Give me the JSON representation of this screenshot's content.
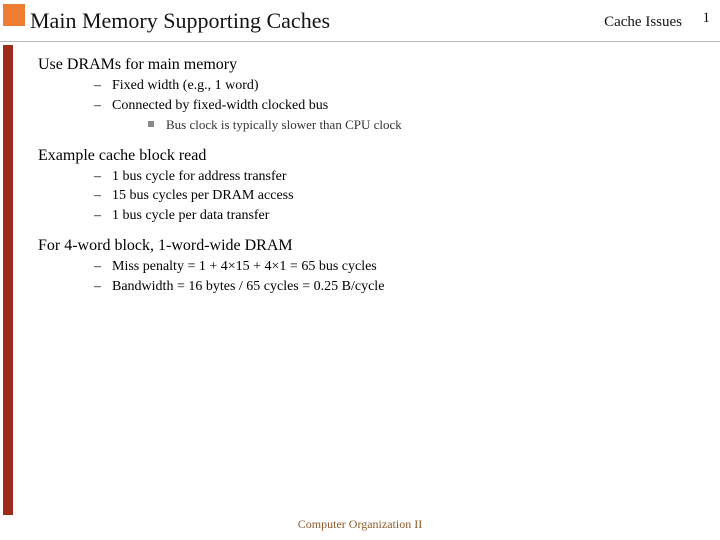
{
  "header": {
    "title": "Main Memory Supporting Caches",
    "subtitle": "Cache Issues",
    "page": "1"
  },
  "content": {
    "sections": [
      {
        "heading": "Use DRAMs for main memory",
        "l1": [
          {
            "text": "Fixed width (e.g., 1 word)",
            "l2": []
          },
          {
            "text": "Connected by fixed-width clocked bus",
            "l2": [
              "Bus clock is typically slower than CPU clock"
            ]
          }
        ]
      },
      {
        "heading": "Example cache block read",
        "l1": [
          {
            "text": "1 bus cycle for address transfer",
            "l2": []
          },
          {
            "text": "15 bus cycles per DRAM access",
            "l2": []
          },
          {
            "text": "1 bus cycle per data transfer",
            "l2": []
          }
        ]
      },
      {
        "heading": "For 4-word block, 1-word-wide DRAM",
        "l1": [
          {
            "text": "Miss penalty = 1 + 4×15 + 4×1 = 65 bus cycles",
            "l2": []
          },
          {
            "text": "Bandwidth = 16 bytes / 65 cycles = 0.25 B/cycle",
            "l2": []
          }
        ]
      }
    ]
  },
  "footer": "Computer Organization II"
}
